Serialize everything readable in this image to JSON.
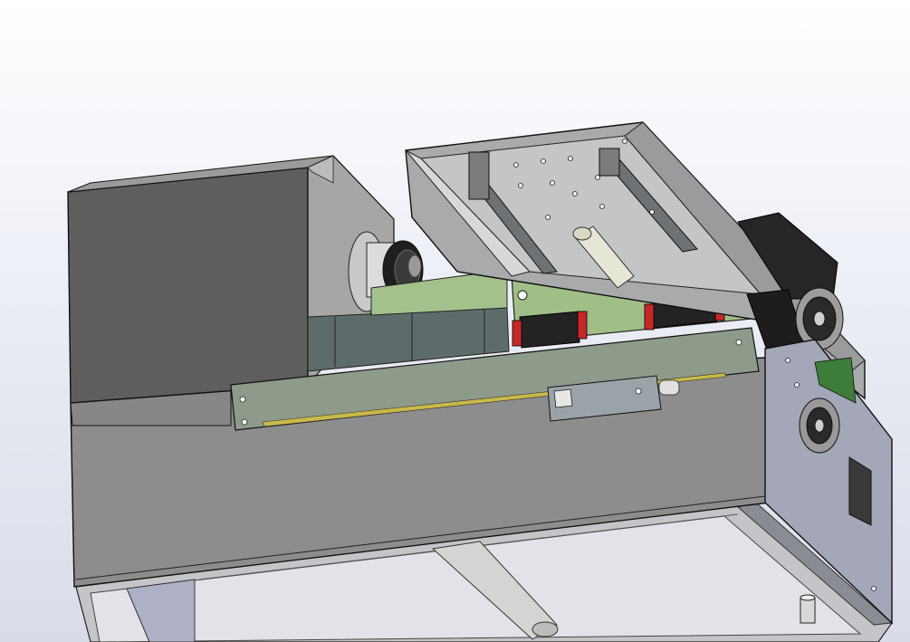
{
  "viewport": {
    "background_top": "#ffffff",
    "background_bottom": "#d9dce8"
  },
  "model": {
    "colors": {
      "housing_dark": "#555555",
      "housing_mid": "#888888",
      "housing_light": "#a9a9a9",
      "housing_side": "#9c9c9c",
      "carriage_plate": "#b4b6b7",
      "pcb_green": "#9fbf86",
      "panel_teal": "#5b6b6a",
      "steel_blue_plate": "#9ea3b4",
      "motor_black": "#222222",
      "rail_red": "#c62828",
      "scale_strip": "#c9b948",
      "edge_line": "#1a1a1a"
    }
  }
}
